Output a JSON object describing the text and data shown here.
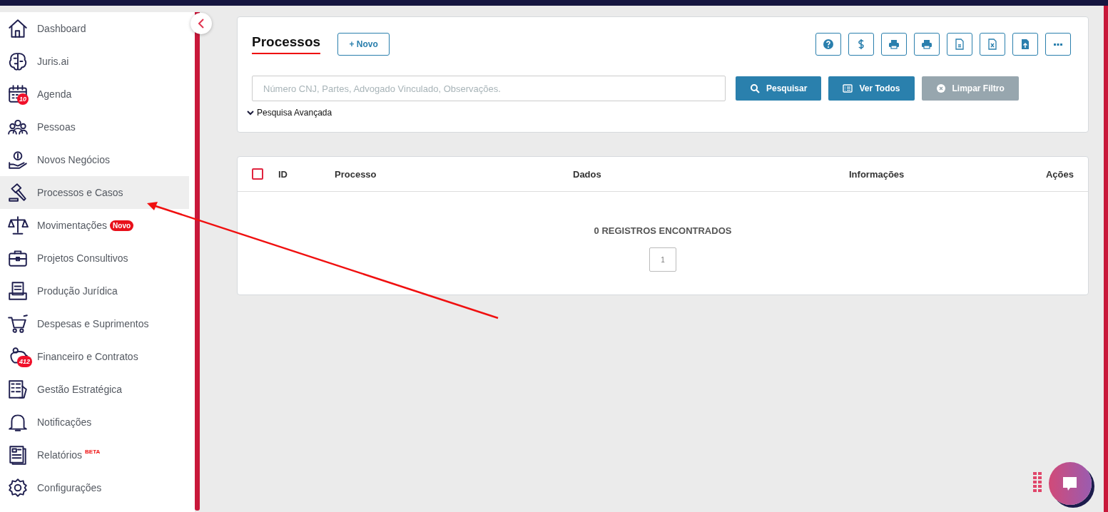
{
  "sidebar": {
    "items": [
      {
        "label": "Dashboard",
        "selected": false
      },
      {
        "label": "Juris.ai",
        "selected": false
      },
      {
        "label": "Agenda",
        "selected": false,
        "badge": {
          "kind": "count",
          "text": "10"
        }
      },
      {
        "label": "Pessoas",
        "selected": false
      },
      {
        "label": "Novos Negócios",
        "selected": false
      },
      {
        "label": "Processos e Casos",
        "selected": true
      },
      {
        "label": "Movimentações",
        "selected": false,
        "badge": {
          "kind": "pill",
          "text": "Novo"
        }
      },
      {
        "label": "Projetos Consultivos",
        "selected": false
      },
      {
        "label": "Produção Jurídica",
        "selected": false
      },
      {
        "label": "Despesas e Suprimentos",
        "selected": false
      },
      {
        "label": "Financeiro e Contratos",
        "selected": false,
        "badge": {
          "kind": "count",
          "text": "412"
        }
      },
      {
        "label": "Gestão Estratégica",
        "selected": false
      },
      {
        "label": "Notificações",
        "selected": false
      },
      {
        "label": "Relatórios",
        "selected": false,
        "badge": {
          "kind": "beta",
          "text": "BETA"
        }
      },
      {
        "label": "Configurações",
        "selected": false
      }
    ]
  },
  "header": {
    "title": "Processos",
    "new_button": "+ Novo"
  },
  "search": {
    "placeholder": "Número CNJ, Partes, Advogado Vinculado, Observações.",
    "advanced_toggle": "Pesquisa Avançada",
    "buttons": [
      {
        "label": "Pesquisar",
        "disabled": false
      },
      {
        "label": "Ver Todos",
        "disabled": false
      },
      {
        "label": "Limpar Filtro",
        "disabled": true
      }
    ]
  },
  "table": {
    "select_all_checked": false,
    "columns": [
      "ID",
      "Processo",
      "Dados",
      "Informações",
      "Ações"
    ],
    "empty_message": "0 REGISTROS ENCONTRADOS",
    "pages": [
      {
        "label": "1",
        "selected": true
      }
    ]
  }
}
